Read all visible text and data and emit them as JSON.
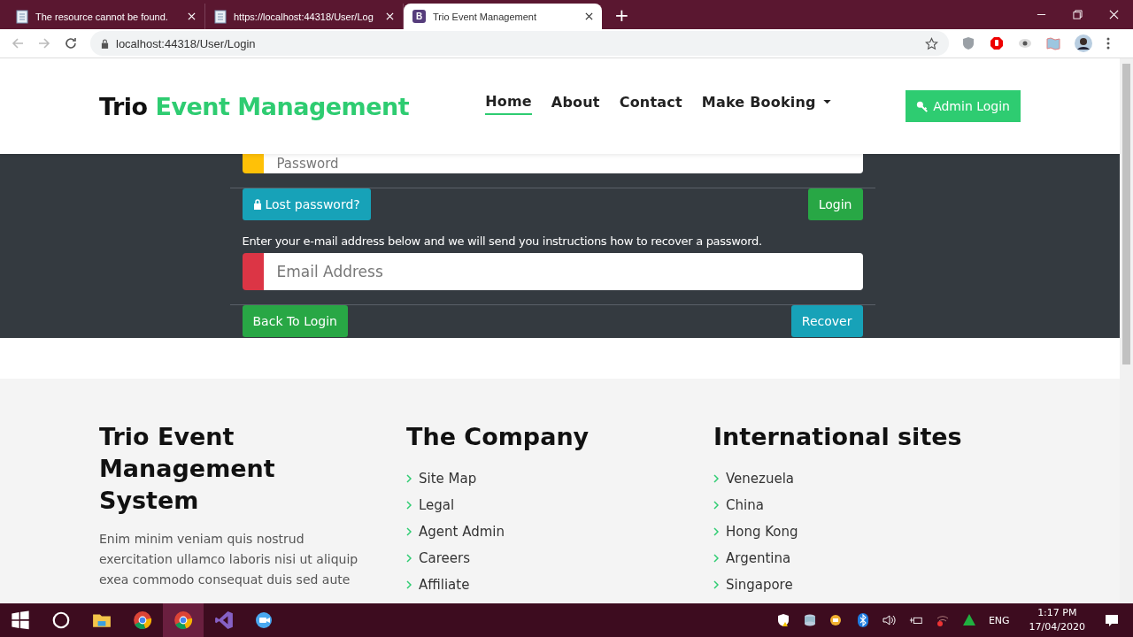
{
  "browser": {
    "tabs": [
      {
        "title": "The resource cannot be found.",
        "selected": false
      },
      {
        "title": "https://localhost:44318/User/Log",
        "selected": false
      },
      {
        "title": "Trio Event Management",
        "selected": true,
        "favicon": "B"
      }
    ],
    "new_tab": "+",
    "address": "localhost:44318/User/Login"
  },
  "header": {
    "brand": "Trio",
    "brand_accent": "Event Management",
    "nav": [
      {
        "label": "Home",
        "selected": true,
        "dropdown": false
      },
      {
        "label": "About",
        "selected": false,
        "dropdown": false
      },
      {
        "label": "Contact",
        "selected": false,
        "dropdown": false
      },
      {
        "label": "Make Booking",
        "selected": false,
        "dropdown": true
      }
    ],
    "admin_button": "Admin Login"
  },
  "form": {
    "password": {
      "placeholder": "Password",
      "color": "#ffc107"
    },
    "lost_button": "Lost password?",
    "login_button": "Login",
    "instructions": "Enter your e-mail address below and we will send you instructions how to recover a password.",
    "email": {
      "placeholder": "Email Address",
      "color": "#dc3545"
    },
    "back_button": "Back To Login",
    "recover_button": "Recover"
  },
  "footer": {
    "about": {
      "title": "Trio Event Management System",
      "text": "Enim minim veniam quis nostrud exercitation ullamco laboris nisi ut aliquip exea commodo consequat duis sed aute"
    },
    "columns": [
      {
        "title": "The Company",
        "links": [
          "Site Map",
          "Legal",
          "Agent Admin",
          "Careers",
          "Affiliate"
        ]
      },
      {
        "title": "International sites",
        "links": [
          "Venezuela",
          "China",
          "Hong Kong",
          "Argentina",
          "Singapore"
        ]
      }
    ]
  },
  "taskbar": {
    "apps": [
      {
        "kind": "windows"
      },
      {
        "kind": "search"
      },
      {
        "kind": "folder"
      },
      {
        "kind": "chrome",
        "selected": false
      },
      {
        "kind": "chrome",
        "selected": true
      },
      {
        "kind": "vs"
      },
      {
        "kind": "video"
      }
    ],
    "language": "ENG",
    "time": "1:17 PM",
    "date": "17/04/2020"
  }
}
